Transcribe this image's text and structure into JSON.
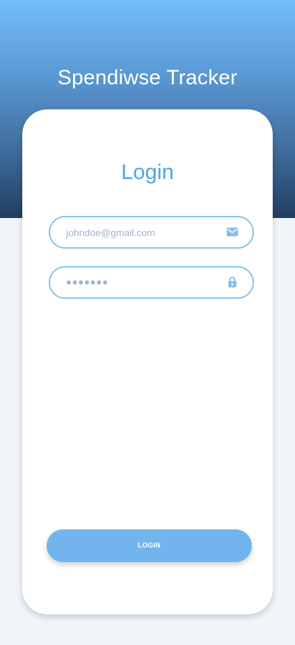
{
  "header": {
    "app_title": "Spendiwse Tracker"
  },
  "login_card": {
    "title": "Login",
    "email": {
      "placeholder": "johndoe@gmail.com",
      "value": "",
      "icon": "mail-icon"
    },
    "password": {
      "placeholder": "•••••••",
      "value": "",
      "icon": "lock-icon"
    },
    "submit_label": "LOGIN"
  },
  "colors": {
    "accent": "#4ea6ea",
    "button": "#72b5ec",
    "field_border": "#85c3f2",
    "icon": "#86bdee",
    "hero_top": "#73bdfb",
    "hero_bottom": "#223e5f",
    "page_background": "#f1f6fa"
  }
}
